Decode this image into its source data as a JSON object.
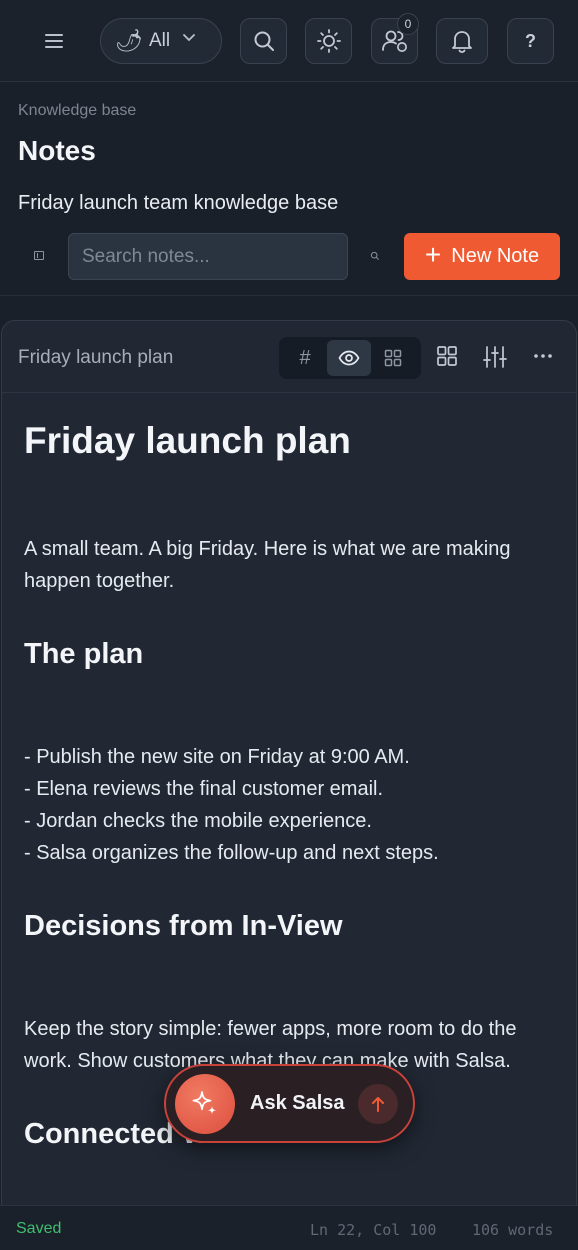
{
  "topbar": {
    "filter_label": "All",
    "filter_icon": "chili-pepper-icon",
    "users_badge": "0",
    "help_label": "?"
  },
  "header": {
    "breadcrumb": "Knowledge base",
    "title": "Notes",
    "subtitle": "Friday launch team knowledge base",
    "search_placeholder": "Search notes...",
    "new_note_label": "New Note"
  },
  "editor": {
    "note_name": "Friday launch plan",
    "view_modes": [
      "markdown",
      "preview",
      "split"
    ],
    "active_mode": "preview",
    "document": {
      "h1": "Friday launch plan",
      "intro": "A small team. A big Friday. Here is what we are making happen together.",
      "h2_plan": "The plan",
      "bullets": [
        "- Publish the new site on Friday at 9:00 AM.",
        "- Elena reviews the final customer email.",
        "- Jordan checks the mobile experience.",
        "- Salsa organizes the follow-up and next steps."
      ],
      "h2_decisions": "Decisions from In-View",
      "decisions_text": "Keep the story simple: fewer apps, more room to do the work. Show customers what they can make with Salsa.",
      "h2_connected": "Connected W"
    }
  },
  "assistant": {
    "label": "Ask Salsa"
  },
  "status": {
    "saved": "Saved",
    "cursor": "Ln 22, Col 100",
    "words": "106 words"
  },
  "colors": {
    "accent": "#f05a32",
    "saved": "#3fbf6f",
    "background": "#1a202a"
  }
}
